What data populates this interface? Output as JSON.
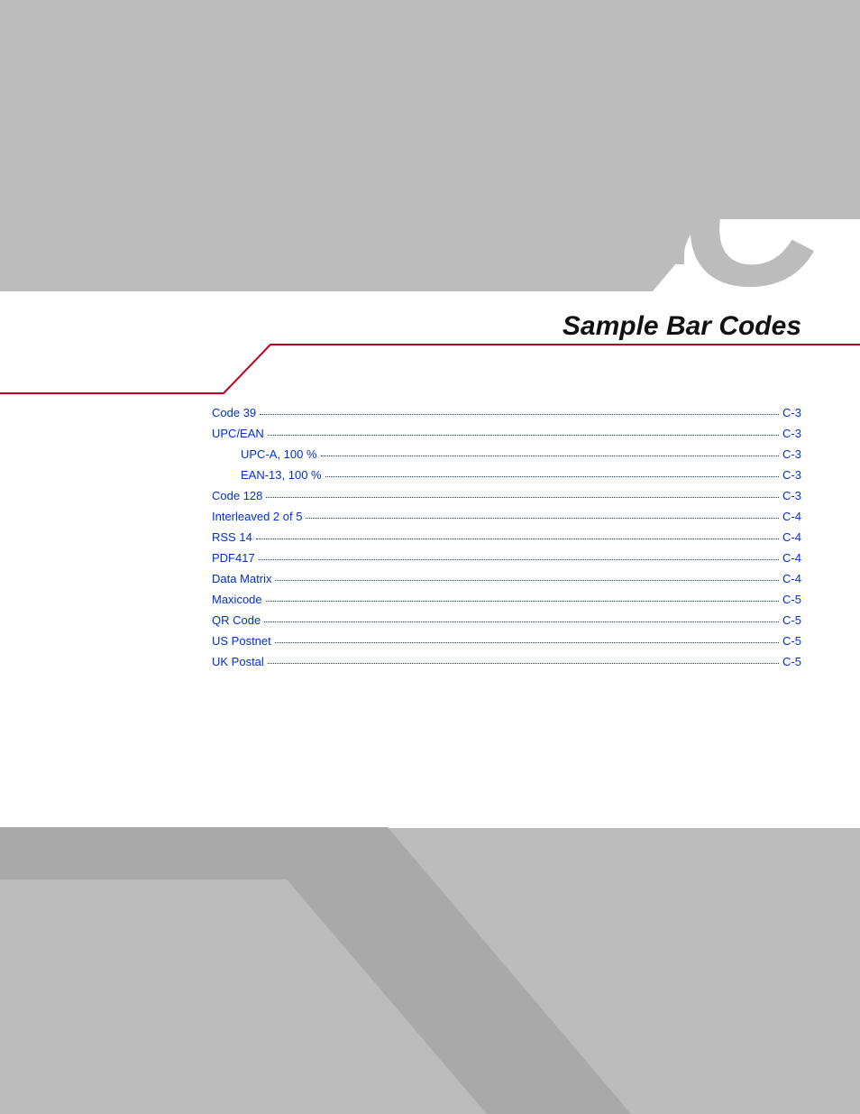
{
  "appendix_letter": "C",
  "title": "Sample Bar Codes",
  "toc": [
    {
      "label": "Code 39",
      "page": "C-3",
      "indent": 0
    },
    {
      "label": "UPC/EAN",
      "page": "C-3",
      "indent": 0
    },
    {
      "label": "UPC-A, 100 %",
      "page": "C-3",
      "indent": 1
    },
    {
      "label": "EAN-13, 100 %",
      "page": "C-3",
      "indent": 1
    },
    {
      "label": "Code 128",
      "page": "C-3",
      "indent": 0
    },
    {
      "label": "Interleaved 2 of 5",
      "page": "C-4",
      "indent": 0
    },
    {
      "label": "RSS 14",
      "page": "C-4",
      "indent": 0
    },
    {
      "label": "PDF417",
      "page": "C-4",
      "indent": 0
    },
    {
      "label": "Data Matrix",
      "page": "C-4",
      "indent": 0
    },
    {
      "label": "Maxicode",
      "page": "C-5",
      "indent": 0
    },
    {
      "label": "QR Code",
      "page": "C-5",
      "indent": 0
    },
    {
      "label": "US Postnet",
      "page": "C-5",
      "indent": 0
    },
    {
      "label": "UK Postal",
      "page": "C-5",
      "indent": 0
    }
  ]
}
